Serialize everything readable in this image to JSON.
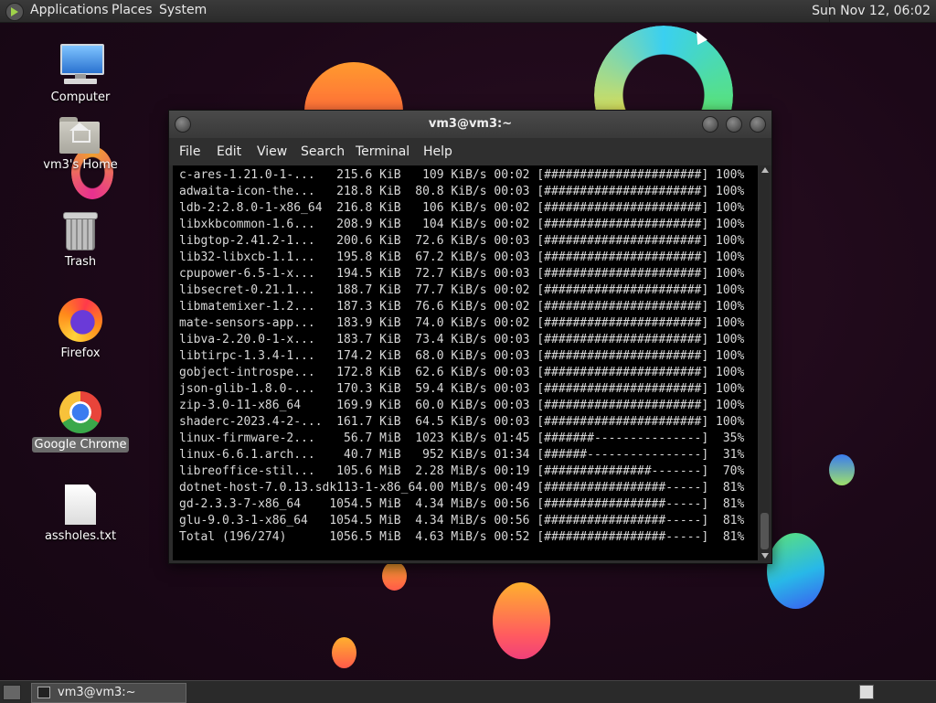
{
  "top_panel": {
    "menus": [
      "Applications",
      "Places",
      "System"
    ],
    "clock": "Sun Nov 12, 06:02"
  },
  "desktop_icons": [
    {
      "label": "Computer",
      "icon": "computer-icon"
    },
    {
      "label": "vm3's Home",
      "icon": "home-folder-icon"
    },
    {
      "label": "Trash",
      "icon": "trash-icon"
    },
    {
      "label": "Firefox",
      "icon": "firefox-icon"
    },
    {
      "label": "Google Chrome",
      "icon": "chrome-icon",
      "selected": true
    },
    {
      "label": "assholes.txt",
      "icon": "text-file-icon"
    }
  ],
  "terminal": {
    "title": "vm3@vm3:~",
    "menu": [
      "File",
      "Edit",
      "View",
      "Search",
      "Terminal",
      "Help"
    ],
    "lines": [
      "c-ares-1.21.0-1-...   215.6 KiB   109 KiB/s 00:02 [######################] 100%",
      "adwaita-icon-the...   218.8 KiB  80.8 KiB/s 00:03 [######################] 100%",
      "ldb-2:2.8.0-1-x86_64  216.8 KiB   106 KiB/s 00:02 [######################] 100%",
      "libxkbcommon-1.6...   208.9 KiB   104 KiB/s 00:02 [######################] 100%",
      "libgtop-2.41.2-1...   200.6 KiB  72.6 KiB/s 00:03 [######################] 100%",
      "lib32-libxcb-1.1...   195.8 KiB  67.2 KiB/s 00:03 [######################] 100%",
      "cpupower-6.5-1-x...   194.5 KiB  72.7 KiB/s 00:03 [######################] 100%",
      "libsecret-0.21.1...   188.7 KiB  77.7 KiB/s 00:02 [######################] 100%",
      "libmatemixer-1.2...   187.3 KiB  76.6 KiB/s 00:02 [######################] 100%",
      "mate-sensors-app...   183.9 KiB  74.0 KiB/s 00:02 [######################] 100%",
      "libva-2.20.0-1-x...   183.7 KiB  73.4 KiB/s 00:03 [######################] 100%",
      "libtirpc-1.3.4-1...   174.2 KiB  68.0 KiB/s 00:03 [######################] 100%",
      "gobject-introspe...   172.8 KiB  62.6 KiB/s 00:03 [######################] 100%",
      "json-glib-1.8.0-...   170.3 KiB  59.4 KiB/s 00:03 [######################] 100%",
      "zip-3.0-11-x86_64     169.9 KiB  60.0 KiB/s 00:03 [######################] 100%",
      "shaderc-2023.4-2-...  161.7 KiB  64.5 KiB/s 00:03 [######################] 100%",
      "linux-firmware-2...    56.7 MiB  1023 KiB/s 01:45 [#######---------------]  35%",
      "linux-6.6.1.arch...    40.7 MiB   952 KiB/s 01:34 [######----------------]  31%",
      "libreoffice-stil...   105.6 MiB  2.28 MiB/s 00:19 [###############-------]  70%",
      "dotnet-host-7.0.13.sdk113-1-x86_64.00 MiB/s 00:49 [#################-----]  81%",
      "gd-2.3.3-7-x86_64    1054.5 MiB  4.34 MiB/s 00:56 [#################-----]  81%",
      "glu-9.0.3-1-x86_64   1054.5 MiB  4.34 MiB/s 00:56 [#################-----]  81%",
      "Total (196/274)      1056.5 MiB  4.63 MiB/s 00:52 [#################-----]  81%"
    ]
  },
  "taskbar": {
    "window_button": "vm3@vm3:~"
  }
}
